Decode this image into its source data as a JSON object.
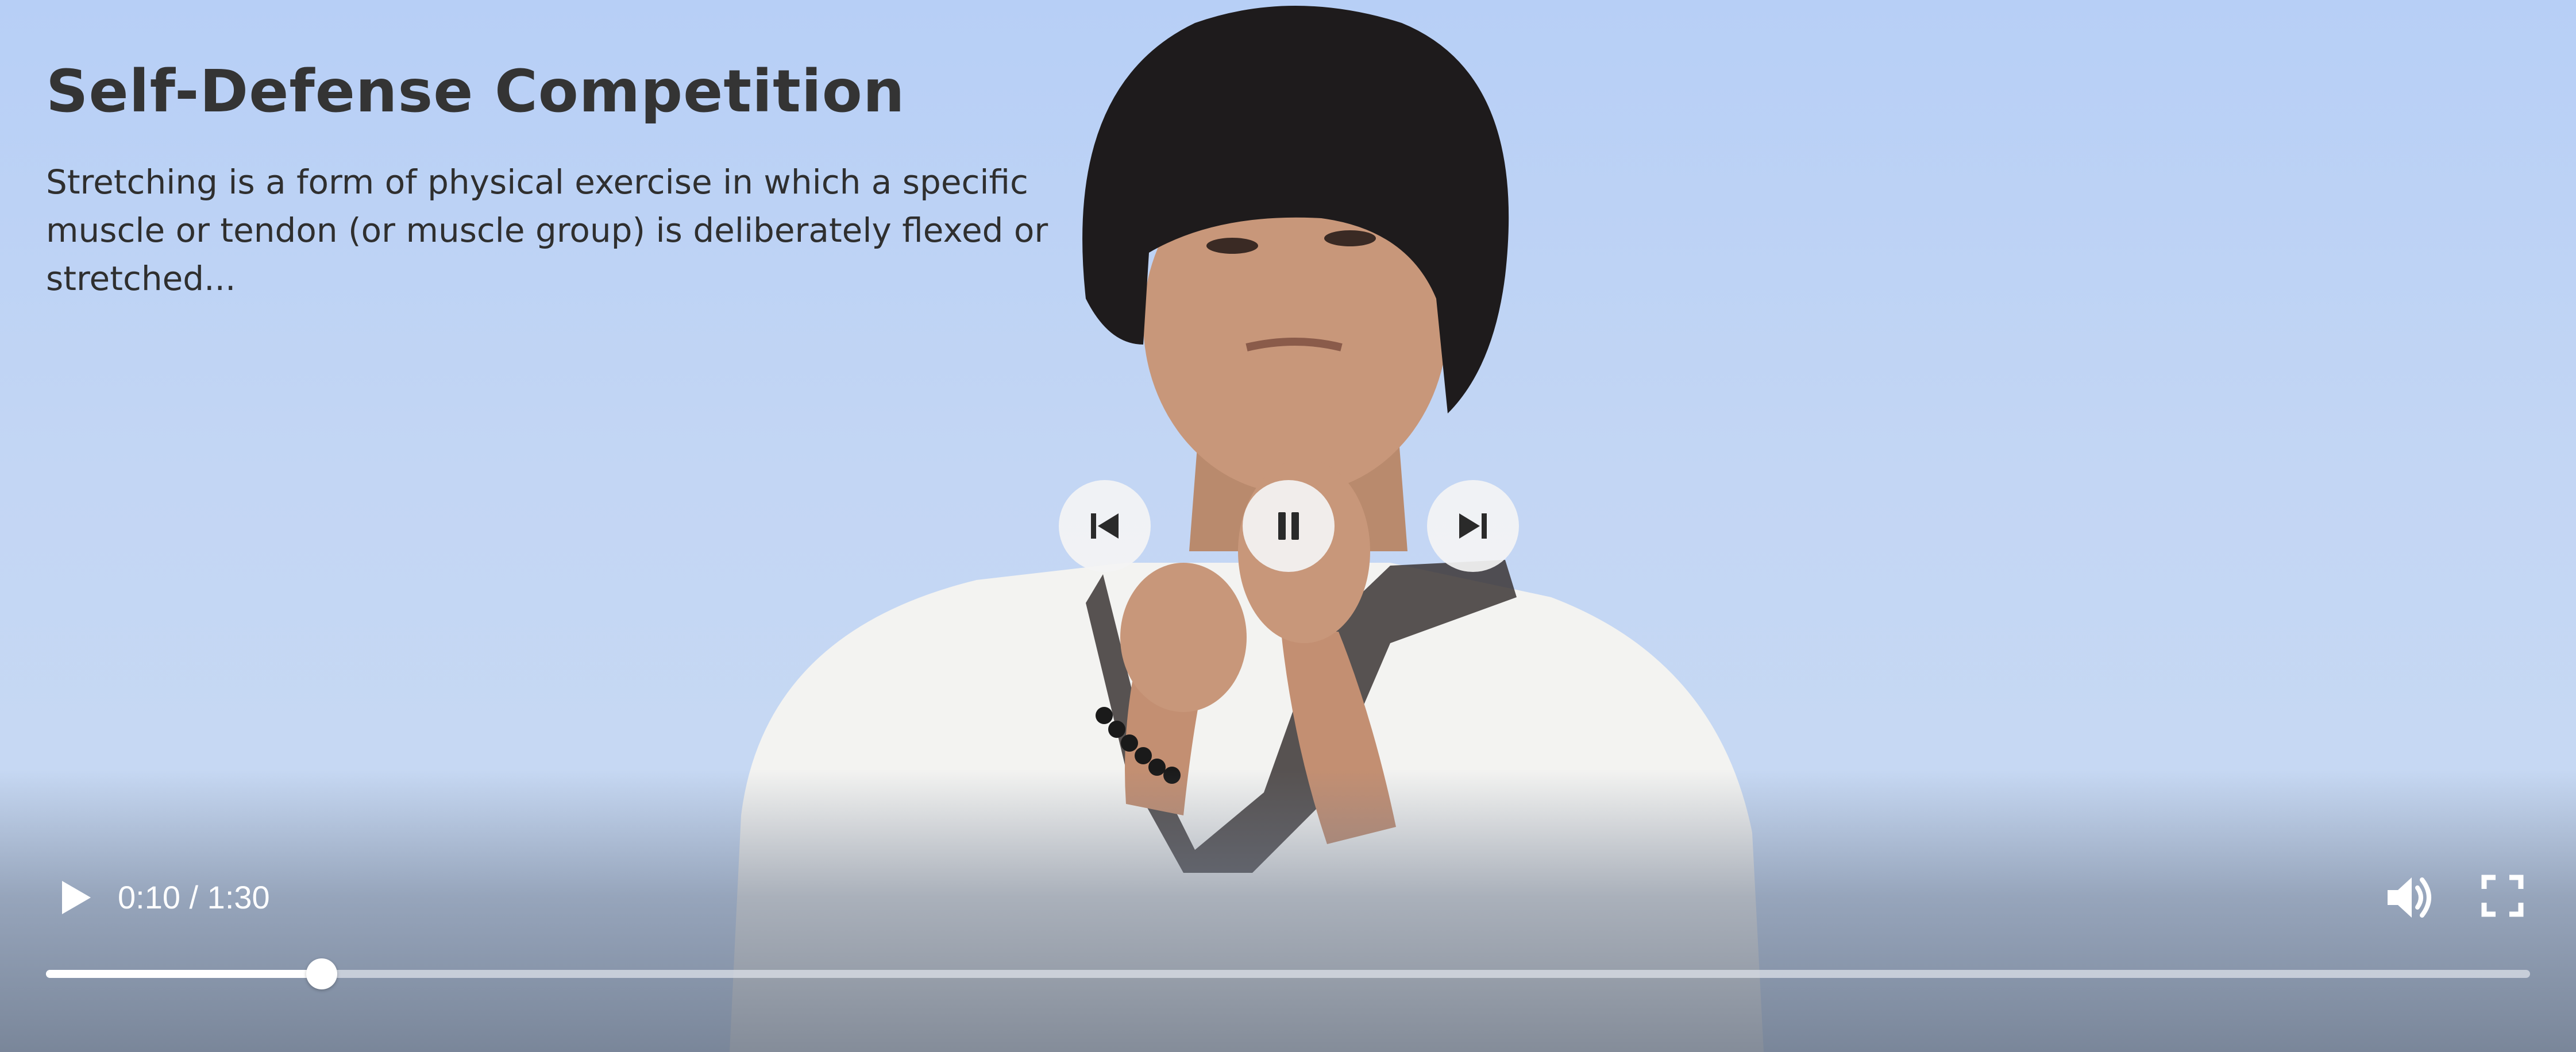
{
  "video": {
    "title": "Self-Defense Competition",
    "description": "Stretching is a form of physical exercise in which a specific muscle or tendon (or muscle group) is deliberately flexed or stretched..."
  },
  "center_controls": {
    "prev_icon": "skip-previous-icon",
    "pause_icon": "pause-icon",
    "next_icon": "skip-next-icon"
  },
  "player_bar": {
    "play_icon": "play-icon",
    "time": "0:10 / 1:30",
    "volume_icon": "volume-icon",
    "fullscreen_icon": "fullscreen-icon",
    "progress": 0.111
  },
  "colors": {
    "sky": "#c3d6f4",
    "title_text": "#343434",
    "control_bg": "#f4f4f4",
    "control_icon": "#2a2a2a"
  }
}
